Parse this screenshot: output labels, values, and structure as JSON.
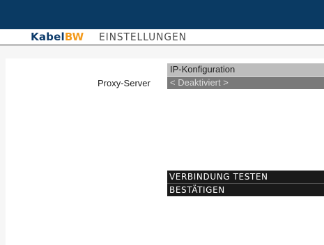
{
  "header": {
    "logo_kabel": "Kabel",
    "logo_bw": "BW",
    "title": "EINSTELLUNGEN"
  },
  "settings": {
    "ip_config_label": "IP-Konfiguration",
    "proxy_label": "Proxy-Server",
    "proxy_value": "< Deaktiviert >"
  },
  "actions": {
    "test_connection": "VERBINDUNG TESTEN",
    "confirm": "BESTÄTIGEN"
  },
  "colors": {
    "top_bar": "#0a3a63",
    "logo_blue": "#0d3b6b",
    "logo_orange": "#f39a1b",
    "action_bg": "#1a1a1a"
  }
}
